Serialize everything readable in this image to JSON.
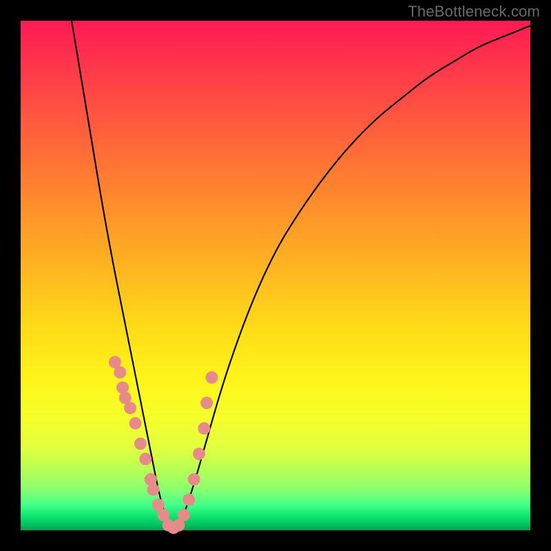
{
  "watermark_text": "TheBottleneck.com",
  "chart_data": {
    "type": "line",
    "title": "",
    "xlabel": "",
    "ylabel": "",
    "x_range": [
      0,
      100
    ],
    "y_range": [
      0,
      100
    ],
    "curve": {
      "name": "bottleneck-curve",
      "x": [
        10,
        12,
        14,
        16,
        18,
        20,
        22,
        24,
        25,
        26,
        27,
        28,
        29,
        30,
        31,
        32,
        34,
        36,
        40,
        45,
        50,
        55,
        60,
        65,
        70,
        75,
        80,
        85,
        90,
        95,
        100
      ],
      "y": [
        100,
        88,
        76,
        64,
        53,
        43,
        33,
        23,
        18,
        13,
        8,
        4,
        1,
        0,
        1,
        3,
        9,
        16,
        30,
        44,
        55,
        63,
        70,
        76,
        81,
        85,
        89,
        92,
        95,
        97,
        99
      ]
    },
    "dots": {
      "name": "data-points",
      "x": [
        18.5,
        19.5,
        20.0,
        20.5,
        21.5,
        22.5,
        23.5,
        24.5,
        25.5,
        26.0,
        27.0,
        28.0,
        29.0,
        30.0,
        31.0,
        32.0,
        33.0,
        34.0,
        35.0,
        36.0,
        36.5,
        37.5
      ],
      "y": [
        33,
        31,
        28,
        26,
        24,
        21,
        17,
        14,
        10,
        8,
        5,
        3,
        1,
        0.5,
        1,
        3,
        6,
        10,
        15,
        20,
        25,
        30
      ]
    },
    "background_gradient": {
      "top": "#ff1a55",
      "mid": "#ffda18",
      "bottom": "#00a050"
    }
  }
}
